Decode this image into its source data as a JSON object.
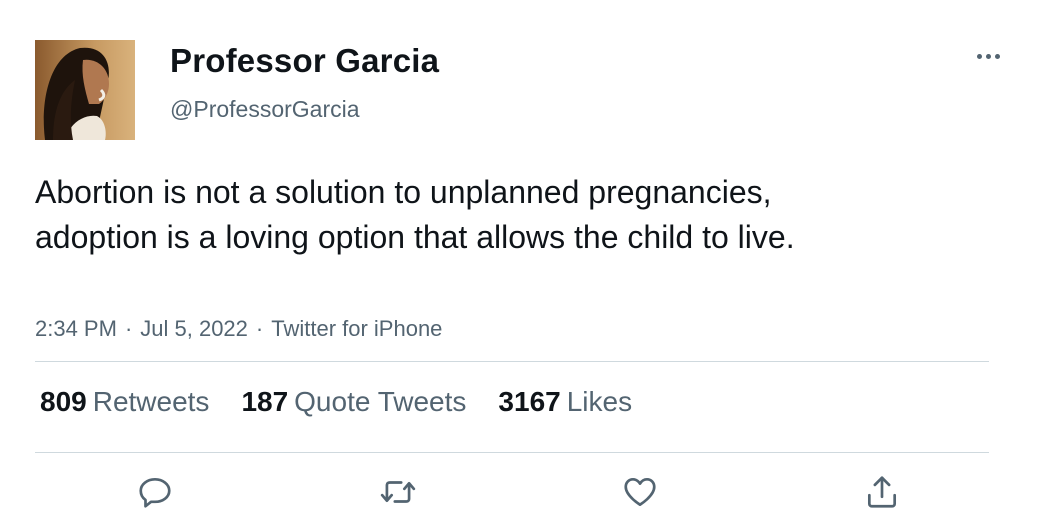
{
  "author": {
    "name": "Professor Garcia",
    "handle": "@ProfessorGarcia"
  },
  "tweet": {
    "text": "Abortion is not a solution to unplanned pregnancies, adoption is a loving option that allows the child to live.",
    "time": "2:34 PM",
    "date": "Jul 5, 2022",
    "source": "Twitter for iPhone",
    "separator": "·"
  },
  "stats": {
    "retweets": {
      "count": "809",
      "label": "Retweets"
    },
    "quotes": {
      "count": "187",
      "label": "Quote Tweets"
    },
    "likes": {
      "count": "3167",
      "label": "Likes"
    }
  },
  "icons": {
    "more": "more-horizontal-icon",
    "reply": "reply-icon",
    "retweet": "retweet-icon",
    "like": "heart-icon",
    "share": "share-icon"
  },
  "colors": {
    "text": "#0f1419",
    "secondary": "#536471",
    "divider": "#cfd9de",
    "background": "#ffffff"
  }
}
